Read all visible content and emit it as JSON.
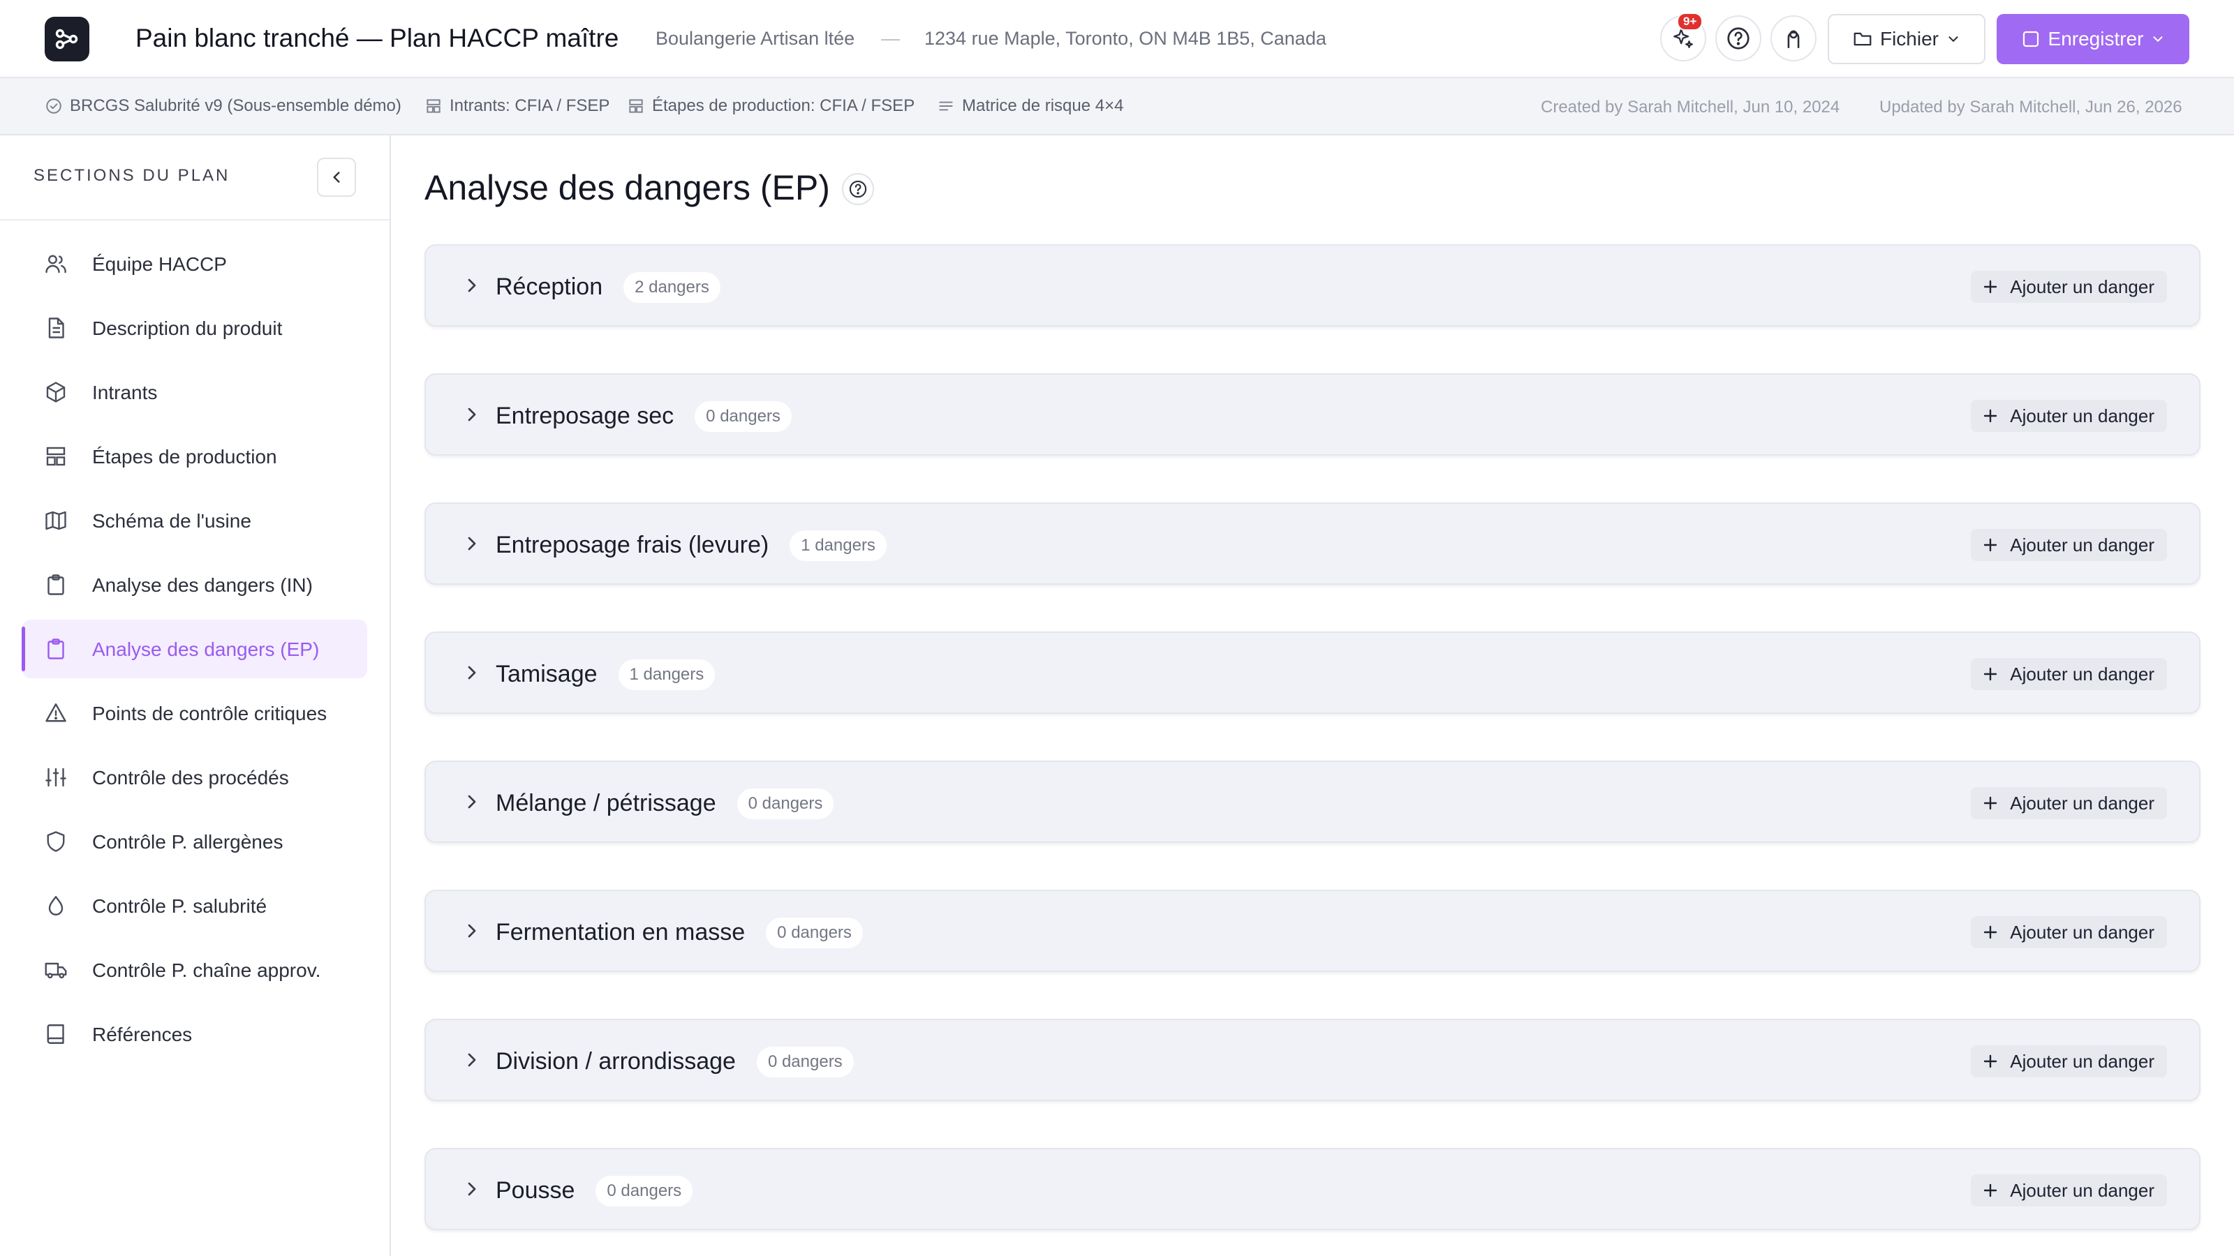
{
  "header": {
    "document_title": "Pain blanc tranché — Plan HACCP maître",
    "company": "Boulangerie Artisan ltée",
    "separator": "—",
    "address": "1234 rue Maple, Toronto, ON M4B 1B5, Canada",
    "notification_badge": "9+",
    "file_label": "Fichier",
    "save_label": "Enregistrer",
    "accent_color": "#a06af2"
  },
  "infobar": {
    "items": [
      {
        "icon": "check-circle-icon",
        "label": "BRCGS Salubrité v9 (Sous-ensemble démo)"
      },
      {
        "icon": "layout-icon",
        "label": "Intrants: CFIA / FSEP"
      },
      {
        "icon": "layout-icon",
        "label": "Étapes de production: CFIA / FSEP"
      },
      {
        "icon": "lines-icon",
        "label": "Matrice de risque 4×4"
      }
    ],
    "created": "Created by Sarah Mitchell, Jun 10, 2024",
    "updated": "Updated by Sarah Mitchell, Jun 26, 2026"
  },
  "sidebar": {
    "title": "SECTIONS DU PLAN",
    "active_index": 6,
    "items": [
      {
        "label": "Équipe HACCP",
        "icon": "users-icon"
      },
      {
        "label": "Description du produit",
        "icon": "document-icon"
      },
      {
        "label": "Intrants",
        "icon": "box-icon"
      },
      {
        "label": "Étapes de production",
        "icon": "layout-icon"
      },
      {
        "label": "Schéma de l'usine",
        "icon": "map-icon"
      },
      {
        "label": "Analyse des dangers (IN)",
        "icon": "clipboard-icon"
      },
      {
        "label": "Analyse des dangers (EP)",
        "icon": "clipboard-icon"
      },
      {
        "label": "Points de contrôle critiques",
        "icon": "warning-icon"
      },
      {
        "label": "Contrôle des procédés",
        "icon": "sliders-icon"
      },
      {
        "label": "Contrôle P. allergènes",
        "icon": "shield-icon"
      },
      {
        "label": "Contrôle P. salubrité",
        "icon": "droplet-icon"
      },
      {
        "label": "Contrôle P. chaîne approv.",
        "icon": "truck-icon"
      },
      {
        "label": "Références",
        "icon": "book-icon"
      }
    ]
  },
  "main": {
    "title": "Analyse des dangers (EP)",
    "add_label": "Ajouter un danger",
    "steps": [
      {
        "name": "Réception",
        "count": "2 dangers"
      },
      {
        "name": "Entreposage sec",
        "count": "0 dangers"
      },
      {
        "name": "Entreposage frais (levure)",
        "count": "1 dangers"
      },
      {
        "name": "Tamisage",
        "count": "1 dangers"
      },
      {
        "name": "Mélange / pétrissage",
        "count": "0 dangers"
      },
      {
        "name": "Fermentation en masse",
        "count": "0 dangers"
      },
      {
        "name": "Division / arrondissage",
        "count": "0 dangers"
      },
      {
        "name": "Pousse",
        "count": "0 dangers"
      }
    ]
  }
}
